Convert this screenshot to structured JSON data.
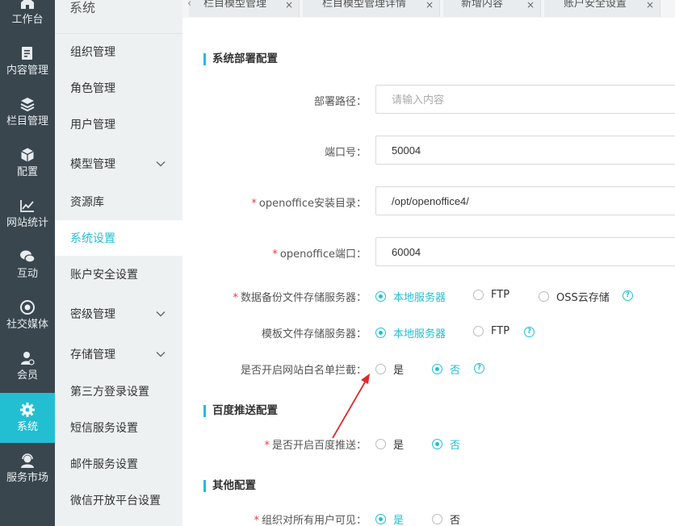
{
  "rail": {
    "items": [
      {
        "label": "工作台",
        "icon": "home-icon"
      },
      {
        "label": "内容管理",
        "icon": "document-edit-icon"
      },
      {
        "label": "栏目管理",
        "icon": "layers-icon"
      },
      {
        "label": "配置",
        "icon": "cube-icon"
      },
      {
        "label": "网站统计",
        "icon": "line-chart-icon"
      },
      {
        "label": "互动",
        "icon": "chat-bubbles-icon"
      },
      {
        "label": "社交媒体",
        "icon": "target-icon"
      },
      {
        "label": "会员",
        "icon": "member-icon"
      },
      {
        "label": "系统",
        "icon": "gear-icon"
      },
      {
        "label": "服务市场",
        "icon": "headset-icon"
      }
    ]
  },
  "submenu": {
    "title": "系统",
    "items": [
      {
        "label": "组织管理"
      },
      {
        "label": "角色管理"
      },
      {
        "label": "用户管理"
      },
      {
        "label": "模型管理"
      },
      {
        "label": "资源库"
      },
      {
        "label": "系统设置"
      },
      {
        "label": "账户安全设置"
      },
      {
        "label": "密级管理"
      },
      {
        "label": "存储管理"
      },
      {
        "label": "第三方登录设置"
      },
      {
        "label": "短信服务设置"
      },
      {
        "label": "邮件服务设置"
      },
      {
        "label": "微信开放平台设置"
      }
    ]
  },
  "tabs": [
    {
      "label": "栏目模型管理"
    },
    {
      "label": "栏目模型管理详情"
    },
    {
      "label": "新增内容"
    },
    {
      "label": "账户安全设置"
    }
  ],
  "tab_close": "×",
  "tab_prev": "‹",
  "form": {
    "deploy_section": "系统部署配置",
    "deploy_path_label": "部署路径：",
    "deploy_path_placeholder": "请输入内容",
    "port_label": "端口号：",
    "port_value": "50004",
    "oo_dir_label": "openoffice安装目录：",
    "oo_dir_value": "/opt/openoffice4/",
    "oo_port_label": "openoffice端口：",
    "oo_port_value": "60004",
    "backup_label": "数据备份文件存储服务器：",
    "backup_options": [
      "本地服务器",
      "FTP",
      "OSS云存储"
    ],
    "template_label": "模板文件存储服务器：",
    "template_options": [
      "本地服务器",
      "FTP"
    ],
    "whitelist_label": "是否开启网站白名单拦截：",
    "whitelist_options": [
      "是",
      "否"
    ],
    "baidu_section": "百度推送配置",
    "baidu_label": "是否开启百度推送：",
    "baidu_options": [
      "是",
      "否"
    ],
    "other_section": "其他配置",
    "org_visible_label": "组织对所有用户可见：",
    "org_visible_options": [
      "是",
      "否"
    ],
    "required_mark": "*",
    "help_glyph": "?"
  },
  "colors": {
    "accent": "#22bfd2",
    "rail_bg": "#39464e",
    "submenu_bg": "#eef1f2",
    "required": "#e83b3b",
    "annotation_arrow": "#e02a2a"
  }
}
